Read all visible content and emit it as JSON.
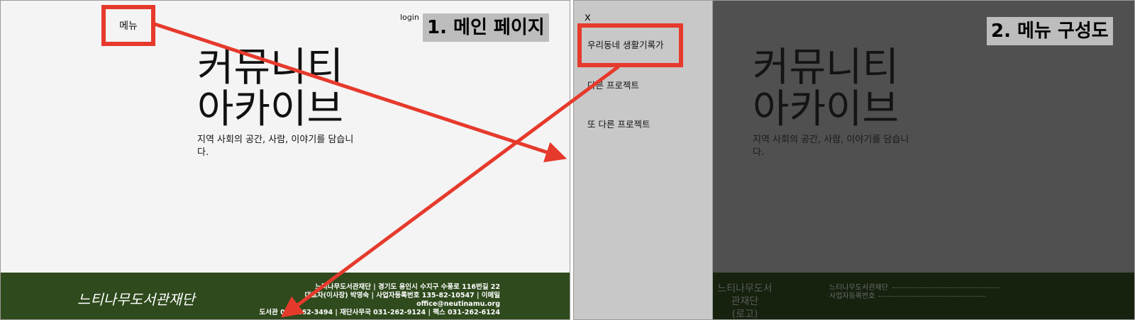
{
  "main_page": {
    "menu_button": "메뉴",
    "login_link": "login",
    "section_tag": "1. 메인 페이지",
    "hero": {
      "title_line1": "커뮤니티",
      "title_line2": "아카이브",
      "subtitle": "지역 사회의 공간, 사람, 이야기를 담습니다."
    },
    "footer": {
      "logo_text": "느티나무도서관재단",
      "line1": "느티나무도서관재단 | 경기도 용인시 수지구 수풍로 116번길 22",
      "line2": "대표자(이사장) 박영숙 | 사업자등록번호 135-82-10547 | 이메일 office@neutinamu.org",
      "line3": "도서관 031-262-3494 | 재단사무국 031-262-9124 | 팩스 031-262-6124"
    }
  },
  "menu_page": {
    "section_tag": "2. 메뉴 구성도",
    "close_label": "x",
    "menu_items": [
      "우리동네 생활기록가",
      "다른 프로젝트",
      "또 다른 프로젝트"
    ],
    "hero": {
      "title_line1": "커뮤니티",
      "title_line2": "아카이브",
      "subtitle": "지역 사회의 공간, 사람, 이야기를 담습니다."
    },
    "footer": {
      "logo_text": "느티나무도서관재단",
      "logo_note": "(로고)",
      "label1": "느티나무도서관재단",
      "label2": "사업자등록번호"
    }
  },
  "colors": {
    "highlight": "#e63a2c",
    "footer_green": "#2f4a1d",
    "overlay_dark": "#505050",
    "drawer_gray": "#c8c8c8"
  }
}
